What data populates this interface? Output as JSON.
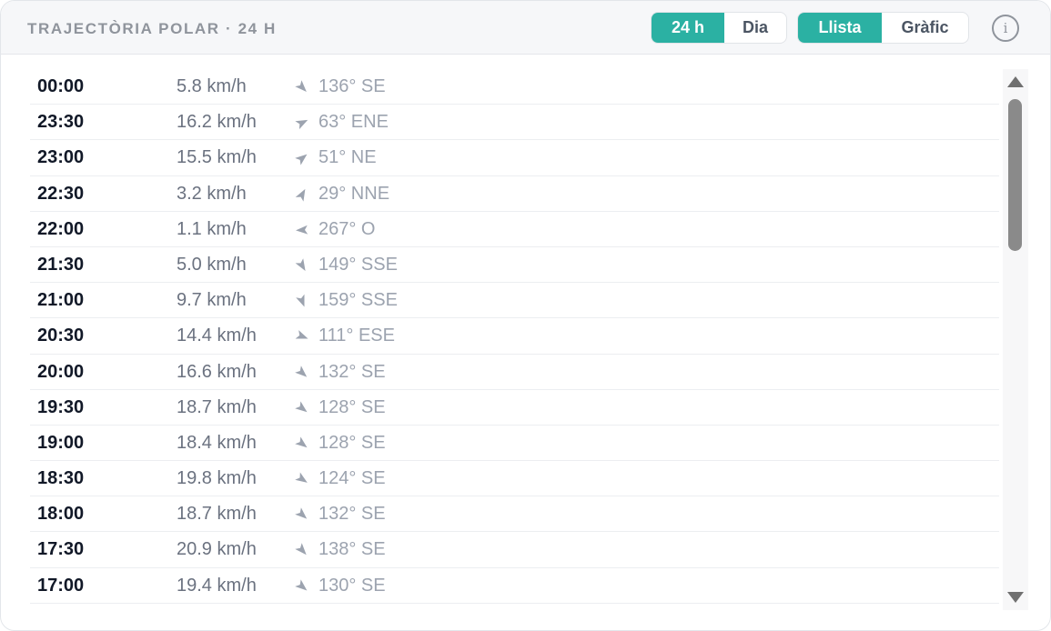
{
  "header": {
    "title": "TRAJECTÒRIA POLAR · 24 H",
    "range_toggle": [
      {
        "label": "24 h",
        "active": true
      },
      {
        "label": "Dia",
        "active": false
      }
    ],
    "view_toggle": [
      {
        "label": "Llista",
        "active": true
      },
      {
        "label": "Gràfic",
        "active": false
      }
    ],
    "info_glyph": "i"
  },
  "colors": {
    "accent": "#2bb1a3",
    "arrow": "#9ca3af"
  },
  "rows": [
    {
      "time": "00:00",
      "speed": "5.8 km/h",
      "deg": 136,
      "dir": "136° SE"
    },
    {
      "time": "23:30",
      "speed": "16.2 km/h",
      "deg": 63,
      "dir": "63° ENE"
    },
    {
      "time": "23:00",
      "speed": "15.5 km/h",
      "deg": 51,
      "dir": "51° NE"
    },
    {
      "time": "22:30",
      "speed": "3.2 km/h",
      "deg": 29,
      "dir": "29° NNE"
    },
    {
      "time": "22:00",
      "speed": "1.1 km/h",
      "deg": 267,
      "dir": "267° O"
    },
    {
      "time": "21:30",
      "speed": "5.0 km/h",
      "deg": 149,
      "dir": "149° SSE"
    },
    {
      "time": "21:00",
      "speed": "9.7 km/h",
      "deg": 159,
      "dir": "159° SSE"
    },
    {
      "time": "20:30",
      "speed": "14.4 km/h",
      "deg": 111,
      "dir": "111° ESE"
    },
    {
      "time": "20:00",
      "speed": "16.6 km/h",
      "deg": 132,
      "dir": "132° SE"
    },
    {
      "time": "19:30",
      "speed": "18.7 km/h",
      "deg": 128,
      "dir": "128° SE"
    },
    {
      "time": "19:00",
      "speed": "18.4 km/h",
      "deg": 128,
      "dir": "128° SE"
    },
    {
      "time": "18:30",
      "speed": "19.8 km/h",
      "deg": 124,
      "dir": "124° SE"
    },
    {
      "time": "18:00",
      "speed": "18.7 km/h",
      "deg": 132,
      "dir": "132° SE"
    },
    {
      "time": "17:30",
      "speed": "20.9 km/h",
      "deg": 138,
      "dir": "138° SE"
    },
    {
      "time": "17:00",
      "speed": "19.4 km/h",
      "deg": 130,
      "dir": "130° SE"
    }
  ]
}
